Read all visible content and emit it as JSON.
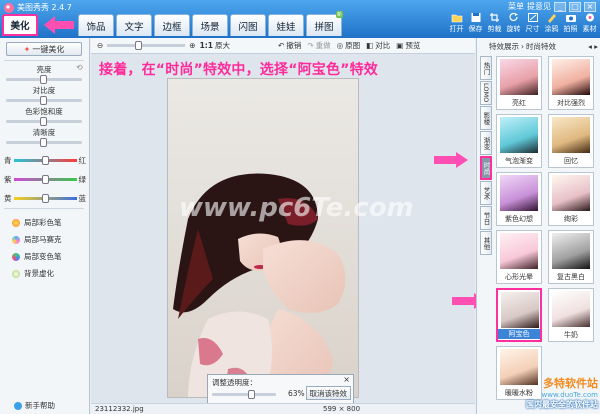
{
  "app": {
    "title": "美图秀秀 2.4.7"
  },
  "window": {
    "menu": "菜单",
    "feedback": "提意见",
    "min": "_",
    "max": "□",
    "close": "×"
  },
  "tabs": [
    {
      "label": "美化",
      "active": true
    },
    {
      "label": "饰品"
    },
    {
      "label": "文字"
    },
    {
      "label": "边框"
    },
    {
      "label": "场景"
    },
    {
      "label": "闪图"
    },
    {
      "label": "娃娃"
    },
    {
      "label": "拼图",
      "badge": "新"
    }
  ],
  "toolbar": [
    {
      "label": "打开",
      "icon": "folder-icon"
    },
    {
      "label": "保存",
      "icon": "save-icon"
    },
    {
      "label": "剪裁",
      "icon": "crop-icon"
    },
    {
      "label": "旋转",
      "icon": "rotate-icon"
    },
    {
      "label": "尺寸",
      "icon": "resize-icon"
    },
    {
      "label": "涂鸦",
      "icon": "brush-icon"
    },
    {
      "label": "拍照",
      "icon": "camera-icon"
    },
    {
      "label": "素材",
      "icon": "material-icon"
    }
  ],
  "left": {
    "one_click": "一键美化",
    "sliders": [
      "亮度",
      "对比度",
      "色彩饱和度",
      "清晰度"
    ],
    "color_rows": [
      {
        "left": "青",
        "right": "红"
      },
      {
        "left": "紫",
        "right": "绿"
      },
      {
        "left": "黄",
        "right": "蓝"
      }
    ],
    "brushes": [
      "局部彩色笔",
      "局部马赛克",
      "局部变色笔",
      "背景虚化"
    ],
    "help": "新手帮助"
  },
  "canvas": {
    "zoom_label": "1:1",
    "original_size": "原大",
    "undo": "撤销",
    "redo": "重做",
    "original": "原图",
    "compare": "对比",
    "preview": "预览",
    "instruction": "接着，在“时尚”特效中，选择“阿宝色”特效",
    "watermark": "www.pc6Te.com",
    "opacity_label": "调整透明度：",
    "opacity_value": "63%",
    "opacity": 0.63,
    "cancel_effect": "取消该特效",
    "file_name": "23112332.jpg",
    "dimensions": "599 × 800"
  },
  "right": {
    "crumb1": "特效展示",
    "crumb2": "时尚特效",
    "categories": [
      "热门",
      "LOMO",
      "影楼",
      "渐变",
      "时尚",
      "艺术",
      "节日",
      "其他"
    ],
    "active_category": "时尚",
    "effects": [
      "亮红",
      "对比强烈",
      "气泡渐变",
      "回忆",
      "紫色幻想",
      "绚彩",
      "心形光晕",
      "复古黑白",
      "阿宝色",
      "牛奶",
      "暖暖水粉"
    ],
    "selected_effect": "阿宝色",
    "brand_name": "多特软件站",
    "brand_url": "www.duoTe.com",
    "brand_slogan": "国内最安全的软件站"
  }
}
